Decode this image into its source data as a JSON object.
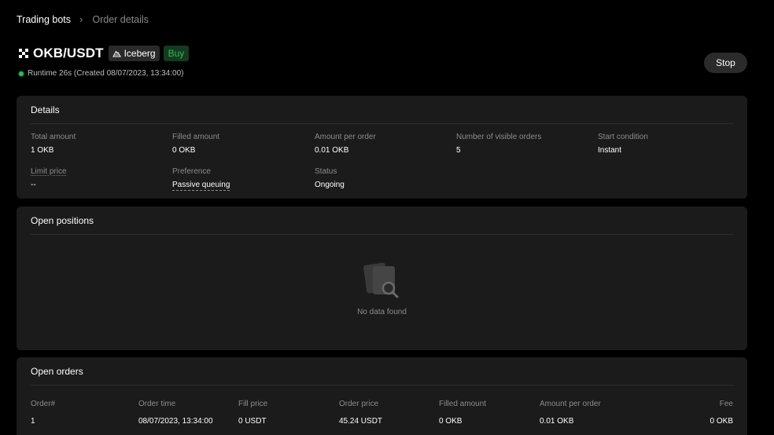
{
  "breadcrumb": {
    "parent": "Trading bots",
    "separator": "›",
    "current": "Order details"
  },
  "header": {
    "pair": "OKB/USDT",
    "strategy_tag": "Iceberg",
    "side_tag": "Buy",
    "runtime": "Runtime 26s (Created 08/07/2023, 13:34:00)",
    "stop_label": "Stop"
  },
  "colors": {
    "background": "#000000",
    "card": "#1b1b1b",
    "accent_green": "#2dbd5b"
  },
  "details": {
    "title": "Details",
    "fields": [
      {
        "label": "Total amount",
        "value": "1 OKB"
      },
      {
        "label": "Filled amount",
        "value": "0 OKB"
      },
      {
        "label": "Amount per order",
        "value": "0.01 OKB"
      },
      {
        "label": "Number of visible orders",
        "value": "5"
      },
      {
        "label": "Start condition",
        "value": "Instant"
      },
      {
        "label": "Limit price",
        "value": "--"
      },
      {
        "label": "Preference",
        "value": "Passive queuing"
      },
      {
        "label": "Status",
        "value": "Ongoing"
      }
    ]
  },
  "open_positions": {
    "title": "Open positions",
    "empty_text": "No data found",
    "empty_icon": "no-data-magnifier-icon"
  },
  "open_orders": {
    "title": "Open orders",
    "columns": [
      "Order#",
      "Order time",
      "Fill price",
      "Order price",
      "Filled amount",
      "Amount per order",
      "Fee"
    ],
    "rows": [
      [
        "1",
        "08/07/2023, 13:34:00",
        "0 USDT",
        "45.24 USDT",
        "0 OKB",
        "0.01 OKB",
        "0 OKB"
      ]
    ]
  }
}
